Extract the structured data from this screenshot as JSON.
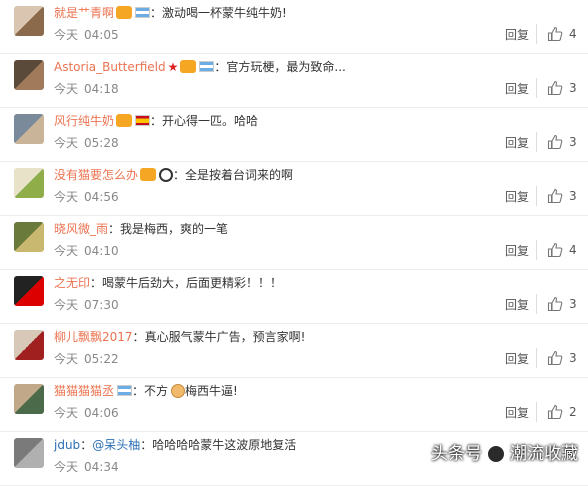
{
  "comments": [
    {
      "user": "就是艹青啊",
      "blue": false,
      "badges": [
        "crown"
      ],
      "flags": [
        "ar"
      ],
      "extra": [],
      "text": "激动喝一杯蒙牛纯牛奶!",
      "day": "今天",
      "time": "04:05",
      "reply": "回复",
      "likes": "4",
      "avatar": [
        "#d9c5b0",
        "#8a6a4a"
      ]
    },
    {
      "user": "Astoria_Butterfield",
      "blue": false,
      "badges": [
        "star",
        "crown"
      ],
      "flags": [
        "ar"
      ],
      "extra": [],
      "text": "官方玩梗，最为致命...",
      "day": "今天",
      "time": "04:18",
      "reply": "回复",
      "likes": "3",
      "avatar": [
        "#5a4a3a",
        "#a07a5a"
      ]
    },
    {
      "user": "风行纯牛奶",
      "blue": false,
      "badges": [
        "crown"
      ],
      "flags": [
        "es"
      ],
      "extra": [],
      "text": "开心得一匹。哈哈",
      "day": "今天",
      "time": "05:28",
      "reply": "回复",
      "likes": "3",
      "avatar": [
        "#7a8a9a",
        "#c9b49a"
      ]
    },
    {
      "user": "没有猫要怎么办",
      "blue": false,
      "badges": [
        "crown"
      ],
      "flags": [],
      "extra": [
        "panda"
      ],
      "text": "全是按着台词来的啊",
      "day": "今天",
      "time": "04:56",
      "reply": "回复",
      "likes": "3",
      "avatar": [
        "#e8e2c8",
        "#8fae4a"
      ]
    },
    {
      "user": "晓风微_雨",
      "blue": false,
      "badges": [],
      "flags": [],
      "extra": [],
      "text": "我是梅西，爽的一笔",
      "day": "今天",
      "time": "04:10",
      "reply": "回复",
      "likes": "4",
      "avatar": [
        "#6a7a3a",
        "#c8b870"
      ]
    },
    {
      "user": "之无印",
      "blue": false,
      "badges": [],
      "flags": [],
      "extra": [],
      "text": "喝蒙牛后劲大，后面更精彩！！！",
      "day": "今天",
      "time": "07:30",
      "reply": "回复",
      "likes": "3",
      "avatar": [
        "#222222",
        "#dd0000"
      ]
    },
    {
      "user": "柳儿飘飘2017",
      "blue": false,
      "badges": [],
      "flags": [],
      "extra": [],
      "text": "真心服气蒙牛广告，预言家啊!",
      "day": "今天",
      "time": "05:22",
      "reply": "回复",
      "likes": "3",
      "avatar": [
        "#d8c8b8",
        "#a02020"
      ]
    },
    {
      "user": "猫猫猫猫丞",
      "blue": false,
      "badges": [],
      "flags": [
        "ar"
      ],
      "extra": [
        "cat"
      ],
      "text_pre": "不方",
      "text": "梅西牛逼!",
      "day": "今天",
      "time": "04:06",
      "reply": "回复",
      "likes": "2",
      "avatar": [
        "#c0a888",
        "#4a6a4a"
      ]
    },
    {
      "user": "jdub",
      "blue": true,
      "badges": [],
      "flags": [],
      "extra": [],
      "mention": "@呆头柚",
      "text": "哈哈哈哈蒙牛这波原地复活",
      "day": "今天",
      "time": "04:34",
      "reply": "",
      "likes": "",
      "avatar": [
        "#7a7a7a",
        "#b0b0b0"
      ]
    }
  ],
  "watermark": {
    "left": "头条号",
    "right": "潮流收藏"
  },
  "colors": {
    "username": "#eb7350",
    "link": "#2d6fb5",
    "time": "#888888"
  }
}
